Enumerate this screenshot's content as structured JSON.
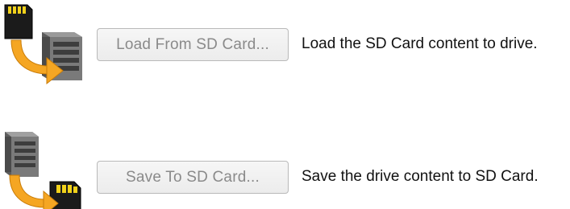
{
  "actions": {
    "load": {
      "button_label": "Load From SD Card...",
      "description": "Load the SD Card content to drive.",
      "icon": "sd-card-to-drive-icon"
    },
    "save": {
      "button_label": "Save To SD Card...",
      "description": "Save the drive content to SD Card.",
      "icon": "drive-to-sd-card-icon"
    }
  },
  "colors": {
    "button_text_disabled": "#8a8a8a",
    "button_border": "#b9b9b9",
    "arrow_orange": "#f5a623",
    "sd_card_dark": "#1b1b1b",
    "sd_contacts": "#f2d21b",
    "drive_gray": "#6f6f6f"
  }
}
